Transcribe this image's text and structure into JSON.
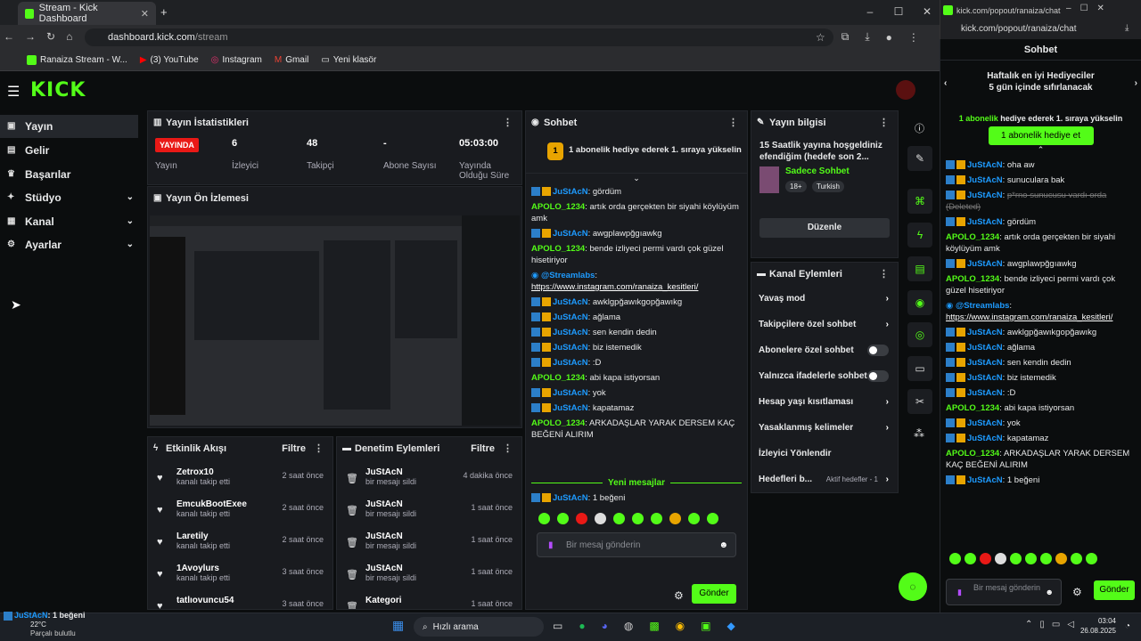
{
  "browser": {
    "tab_title": "Stream - Kick Dashboard",
    "url_host": "dashboard.kick.com",
    "url_path": "/stream",
    "bookmarks": [
      "Ranaiza Stream - W...",
      "(3) YouTube",
      "Instagram",
      "Gmail",
      "Yeni klasör"
    ]
  },
  "popout": {
    "title": "kick.com/popout/ranaiza/chat",
    "url": "kick.com/popout/ranaiza/chat"
  },
  "sidebar": {
    "items": [
      {
        "label": "Yayın",
        "icon": "broadcast-icon"
      },
      {
        "label": "Gelir",
        "icon": "money-icon"
      },
      {
        "label": "Başarılar",
        "icon": "trophy-icon"
      },
      {
        "label": "Stüdyo",
        "icon": "studio-icon"
      },
      {
        "label": "Kanal",
        "icon": "channel-icon"
      },
      {
        "label": "Ayarlar",
        "icon": "gear-icon"
      }
    ]
  },
  "stats": {
    "title": "Yayın İstatistikleri",
    "live": "YAYINDA",
    "live_label": "Yayın",
    "viewers": "6",
    "viewers_label": "İzleyici",
    "followers": "48",
    "followers_label": "Takipçi",
    "subs": "-",
    "subs_label": "Abone Sayısı",
    "duration": "05:03:00",
    "duration_label": "Yayında Olduğu Süre"
  },
  "preview": {
    "title": "Yayın Ön İzlemesi"
  },
  "activity": {
    "title": "Etkinlik Akışı",
    "filter": "Filtre",
    "items": [
      {
        "name": "Zetrox10",
        "sub": "kanalı takip etti",
        "time": "2 saat önce"
      },
      {
        "name": "EmcukBootExee",
        "sub": "kanalı takip etti",
        "time": "2 saat önce"
      },
      {
        "name": "Laretily",
        "sub": "kanalı takip etti",
        "time": "2 saat önce"
      },
      {
        "name": "1Avoylurs",
        "sub": "kanalı takip etti",
        "time": "3 saat önce"
      },
      {
        "name": "tatlıovuncu54",
        "sub": "",
        "time": "3 saat önce"
      }
    ]
  },
  "moderation": {
    "title": "Denetim Eylemleri",
    "filter": "Filtre",
    "items": [
      {
        "name": "JuStAcN",
        "sub": "bir mesajı sildi",
        "time": "4 dakika önce"
      },
      {
        "name": "JuStAcN",
        "sub": "bir mesajı sildi",
        "time": "1 saat önce"
      },
      {
        "name": "JuStAcN",
        "sub": "bir mesajı sildi",
        "time": "1 saat önce"
      },
      {
        "name": "JuStAcN",
        "sub": "bir mesajı sildi",
        "time": "1 saat önce"
      },
      {
        "name": "Kategori",
        "sub": "",
        "time": "1 saat önce"
      }
    ]
  },
  "chat": {
    "title": "Sohbet",
    "goal": "1 abonelik hediye ederek 1. sıraya yükselin",
    "goal_num": "1",
    "messages": [
      {
        "user": "JuStAcN",
        "text": "gördüm",
        "type": "u1"
      },
      {
        "user": "APOLO_1234",
        "text": "artık orda gerçekten bir siyahi köylüyüm amk",
        "type": "u2"
      },
      {
        "user": "JuStAcN",
        "text": "awgplawpğgıawkg",
        "type": "u1"
      },
      {
        "user": "APOLO_1234",
        "text": "bende izliyeci permi vardı çok güzel hisetiriyor",
        "type": "u2"
      },
      {
        "user": "@Streamlabs",
        "text": "https://www.instagram.com/ranaiza_kesitleri/",
        "type": "bot"
      },
      {
        "user": "JuStAcN",
        "text": "awklgpğawıkgopğawıkg",
        "type": "u1"
      },
      {
        "user": "JuStAcN",
        "text": "ağlama",
        "type": "u1"
      },
      {
        "user": "JuStAcN",
        "text": "sen kendin dedin",
        "type": "u1"
      },
      {
        "user": "JuStAcN",
        "text": "biz istemedik",
        "type": "u1"
      },
      {
        "user": "JuStAcN",
        "text": ":D",
        "type": "u1"
      },
      {
        "user": "APOLO_1234",
        "text": "abi kapa istiyorsan",
        "type": "u2"
      },
      {
        "user": "JuStAcN",
        "text": "yok",
        "type": "u1"
      },
      {
        "user": "JuStAcN",
        "text": "kapatamaz",
        "type": "u1"
      },
      {
        "user": "APOLO_1234",
        "text": "ARKADAŞLAR YARAK DERSEM KAÇ BEĞENİ ALIRIM",
        "type": "u2"
      }
    ],
    "new_messages": "Yeni mesajlar",
    "last": {
      "user": "JuStAcN",
      "text": "1 beğeni"
    },
    "placeholder": "Bir mesaj gönderin",
    "send": "Gönder"
  },
  "streaminfo": {
    "title": "Yayın bilgisi",
    "stream_title": "15 Saatlik yayına hoşgeldiniz efendiğim (hedefe son 2...",
    "category": "Sadece Sohbet",
    "tag1": "18+",
    "tag2": "Turkish",
    "edit": "Düzenle"
  },
  "actions": {
    "title": "Kanal Eylemleri",
    "items": [
      {
        "label": "Yavaş mod",
        "kind": "arrow"
      },
      {
        "label": "Takipçilere özel sohbet",
        "kind": "arrow"
      },
      {
        "label": "Abonelere özel sohbet",
        "kind": "toggle"
      },
      {
        "label": "Yalnızca ifadelerle sohbet",
        "kind": "toggle"
      },
      {
        "label": "Hesap yaşı kısıtlaması",
        "kind": "arrow"
      },
      {
        "label": "Yasaklanmış kelimeler",
        "kind": "arrow"
      },
      {
        "label": "İzleyici Yönlendir",
        "kind": "none"
      },
      {
        "label": "Hedefleri b...",
        "kind": "arrow",
        "extra": "Aktif hedefler - 1"
      }
    ]
  },
  "popchat": {
    "title": "Sohbet",
    "leader_title": "Haftalık en iyi Hediyeciler",
    "leader_sub": "5 gün içinde sıfırlanacak",
    "goal_text": "1 abonelik hediye ederek 1. sıraya yükselin",
    "goal_strong": "1 abonelik",
    "gift_btn": "1 abonelik hediye et",
    "messages": [
      {
        "user": "JuStAcN",
        "text": "oha aw",
        "type": "u1"
      },
      {
        "user": "JuStAcN",
        "text": "sunuculara bak",
        "type": "u1"
      },
      {
        "user": "JuStAcN",
        "text": "p*rno sunucusu vardı orda (Deleted)",
        "type": "del"
      },
      {
        "user": "JuStAcN",
        "text": "gördüm",
        "type": "u1"
      },
      {
        "user": "APOLO_1234",
        "text": "artık orda gerçekten bir siyahi köylüyüm amk",
        "type": "u2"
      },
      {
        "user": "JuStAcN",
        "text": "awgplawpğgıawkg",
        "type": "u1"
      },
      {
        "user": "APOLO_1234",
        "text": "bende izliyeci permi vardı çok güzel hisetiriyor",
        "type": "u2"
      },
      {
        "user": "@Streamlabs",
        "text": "https://www.instagram.com/ranaiza_kesitleri/",
        "type": "bot"
      },
      {
        "user": "JuStAcN",
        "text": "awklgpğawıkgopğawıkg",
        "type": "u1"
      },
      {
        "user": "JuStAcN",
        "text": "ağlama",
        "type": "u1"
      },
      {
        "user": "JuStAcN",
        "text": "sen kendin dedin",
        "type": "u1"
      },
      {
        "user": "JuStAcN",
        "text": "biz istemedik",
        "type": "u1"
      },
      {
        "user": "JuStAcN",
        "text": ":D",
        "type": "u1"
      },
      {
        "user": "APOLO_1234",
        "text": "abi kapa istiyorsan",
        "type": "u2"
      },
      {
        "user": "JuStAcN",
        "text": "yok",
        "type": "u1"
      },
      {
        "user": "JuStAcN",
        "text": "kapatamaz",
        "type": "u1"
      },
      {
        "user": "APOLO_1234",
        "text": "ARKADAŞLAR YARAK DERSEM KAÇ BEĞENİ ALIRIM",
        "type": "u2"
      },
      {
        "user": "JuStAcN",
        "text": "1 beğeni",
        "type": "u1"
      }
    ],
    "placeholder": "Bir mesaj gönderin",
    "send": "Gönder"
  },
  "taskbar": {
    "search": "Hızlı arama",
    "weather": "22°C",
    "weather_sub": "Parçalı bulutlu",
    "time": "03:04",
    "date": "26.08.2025",
    "overlay_user": "JuStAcN",
    "overlay_text": "1 beğeni"
  },
  "colors": {
    "accent": "#53fc18",
    "live": "#e91916",
    "user_blue": "#1e9bff"
  }
}
